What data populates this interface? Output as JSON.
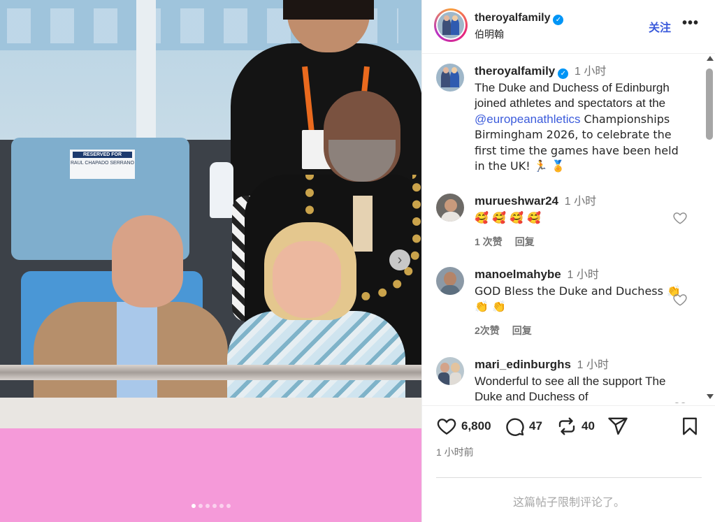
{
  "header": {
    "username": "theroyalfamily",
    "subtitle": "伯明翰",
    "follow_label": "关注",
    "more_label": "•••"
  },
  "caption": {
    "username": "theroyalfamily",
    "time": "1 小时",
    "text_before": "The Duke and Duchess of Edinburgh joined athletes and spectators at the ",
    "mention": "@europeanathletics",
    "text_after": " Championships Birmingham 2026, to celebrate the first time the games have been held in the UK! 🏃 🏅"
  },
  "comments": [
    {
      "username": "murueshwar24",
      "time": "1 小时",
      "text": "🥰 🥰 🥰 🥰",
      "likes": "1 次赞",
      "reply": "回复"
    },
    {
      "username": "manoelmahybe",
      "time": "1 小时",
      "text": "GOD Bless the Duke and Duchess 👏 👏 👏",
      "likes": "2次赞",
      "reply": "回复"
    },
    {
      "username": "mari_edinburghs",
      "time": "1 小时",
      "text": "Wonderful to see all the support The Duke and Duchess of"
    }
  ],
  "photo": {
    "reserved_title": "RESERVED FOR",
    "reserved_name": "RAUL CHAPADO SERRANO",
    "carousel_count": 6,
    "carousel_active": 1
  },
  "actions": {
    "likes": "6,800",
    "comments": "47",
    "reposts": "40"
  },
  "post_time": "1 小时前",
  "comments_restricted": "这篇帖子限制评论了。",
  "colors": {
    "accent": "#3b5bdb",
    "verified": "#0095f6",
    "muted": "#737373"
  },
  "icons": [
    "heart-icon",
    "comment-icon",
    "repost-icon",
    "share-icon",
    "bookmark-icon",
    "chevron-right-icon",
    "verified-icon"
  ]
}
